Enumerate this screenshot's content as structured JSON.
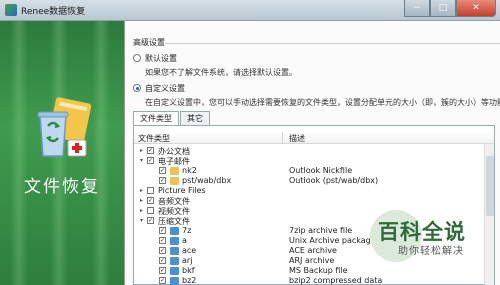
{
  "window": {
    "title": "Renee数据恢复",
    "controls": [
      "−",
      "□",
      "✕"
    ]
  },
  "sidebar": {
    "title": "文件恢复"
  },
  "section": {
    "title": "高级设置"
  },
  "options": {
    "default_label": "默认设置",
    "default_hint": "如果您不了解文件系统，请选择默认设置。",
    "custom_label": "自定义设置",
    "custom_hint": "在自定义设置中，您可以手动选择需要恢复的文件类型，设置分配单元的大小（即，簇的大小）等功能。",
    "selected": "custom"
  },
  "tabs": [
    {
      "label": "文件类型",
      "active": true
    },
    {
      "label": "其它",
      "active": false
    }
  ],
  "table": {
    "columns": [
      "文件类型",
      "描述"
    ],
    "rows": [
      {
        "name": "办公文档",
        "desc": "",
        "level": 0,
        "expand": "▸",
        "checked": true
      },
      {
        "name": "电子邮件",
        "desc": "",
        "level": 0,
        "expand": "▾",
        "checked": true
      },
      {
        "name": "nk2",
        "desc": "Outlook Nickfile",
        "level": 1,
        "expand": "",
        "checked": true,
        "icon": "#e7c35a"
      },
      {
        "name": "pst/wab/dbx",
        "desc": "Outlook (pst/wab/dbx)",
        "level": 1,
        "expand": "",
        "checked": true,
        "icon": "#e7c35a"
      },
      {
        "name": "Picture Files",
        "desc": "",
        "level": 0,
        "expand": "▸",
        "checked": false
      },
      {
        "name": "音频文件",
        "desc": "",
        "level": 0,
        "expand": "▸",
        "checked": true
      },
      {
        "name": "视频文件",
        "desc": "",
        "level": 0,
        "expand": "▸",
        "checked": false
      },
      {
        "name": "压缩文件",
        "desc": "",
        "level": 0,
        "expand": "▾",
        "checked": true
      },
      {
        "name": "7z",
        "desc": "7zip archive file",
        "level": 1,
        "expand": "",
        "checked": true,
        "icon": "#4d8fcf"
      },
      {
        "name": "a",
        "desc": "Unix Archive packag",
        "level": 1,
        "expand": "",
        "checked": true,
        "icon": "#4d8fcf"
      },
      {
        "name": "ace",
        "desc": "ACE archive",
        "level": 1,
        "expand": "",
        "checked": true,
        "icon": "#4d8fcf"
      },
      {
        "name": "arj",
        "desc": "ARJ archive",
        "level": 1,
        "expand": "",
        "checked": true,
        "icon": "#4d8fcf"
      },
      {
        "name": "bkf",
        "desc": "MS Backup file",
        "level": 1,
        "expand": "",
        "checked": true,
        "icon": "#4d8fcf"
      },
      {
        "name": "bz2",
        "desc": "bzip2 compressed data",
        "level": 1,
        "expand": "",
        "checked": true,
        "icon": "#4d8fcf"
      }
    ]
  },
  "watermark": {
    "main": "百科全说",
    "sub": "助你轻松解决"
  }
}
